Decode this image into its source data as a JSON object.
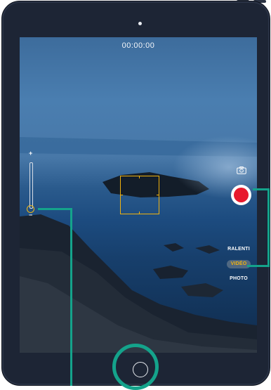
{
  "camera": {
    "timer": "00:00:00",
    "zoom_plus": "+",
    "zoom_minus": "−",
    "modes": [
      "RALENTI",
      "VIDÉO",
      "PHOTO"
    ],
    "active_mode": "VIDÉO",
    "record_color": "#e8192c",
    "accent_color": "#f0b20f"
  },
  "annotation": {
    "callout_color": "#14a38b"
  },
  "icons": [
    "switch-camera-icon",
    "home-button-icon",
    "record-icon"
  ]
}
